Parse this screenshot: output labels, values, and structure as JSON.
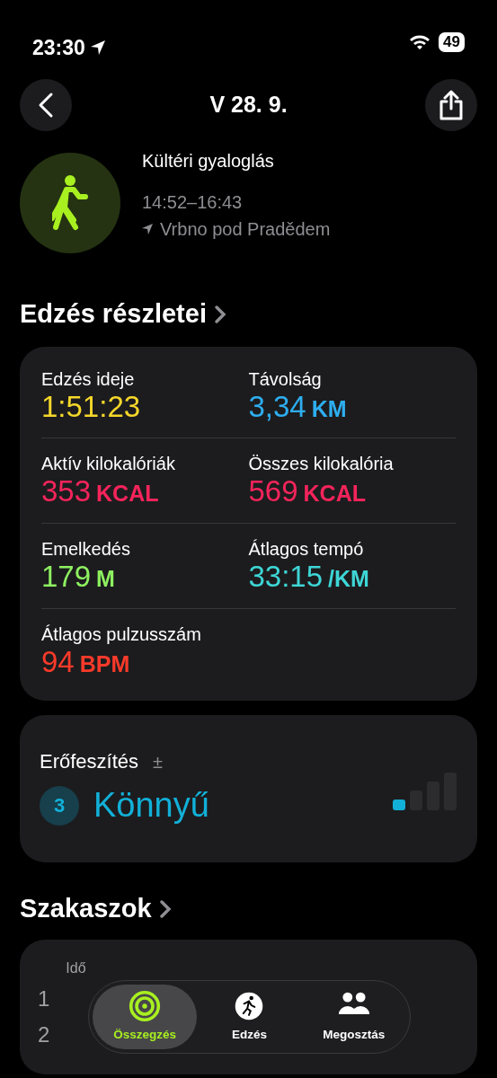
{
  "status_bar": {
    "time": "23:30",
    "battery": "49"
  },
  "header": {
    "title": "V 28. 9."
  },
  "workout": {
    "name": "Kültéri gyaloglás",
    "time_range": "14:52–16:43",
    "location": "Vrbno pod Pradědem"
  },
  "details": {
    "title": "Edzés részletei",
    "metrics": [
      {
        "label": "Edzés ideje",
        "value": "1:51:23",
        "color": "#f5d72a"
      },
      {
        "label": "Távolság",
        "value": "3,34",
        "unit": "KM",
        "color": "#2eaef0"
      },
      {
        "label": "Aktív kilokalóriák",
        "value": "353",
        "unit": "KCAL",
        "color": "#f5245b"
      },
      {
        "label": "Összes kilokalória",
        "value": "569",
        "unit": "KCAL",
        "color": "#f5245b"
      },
      {
        "label": "Emelkedés",
        "value": "179",
        "unit": "M",
        "color": "#8ef060"
      },
      {
        "label": "Átlagos tempó",
        "value": "33:15",
        "unit": "/KM",
        "color": "#3ed6d6"
      },
      {
        "label": "Átlagos pulzusszám",
        "value": "94",
        "unit": "BPM",
        "color": "#fa3a2a"
      }
    ]
  },
  "effort": {
    "label": "Erőfeszítés",
    "adjust": "±",
    "score": "3",
    "rating": "Könnyű",
    "level": 0.25
  },
  "segments": {
    "title": "Szakaszok",
    "column_1": "Idő",
    "rows": [
      {
        "index": "1"
      },
      {
        "index": "2"
      }
    ]
  },
  "tabs": [
    {
      "label": "Összegzés",
      "kind": "rings",
      "selected": true
    },
    {
      "label": "Edzés",
      "kind": "run",
      "selected": false
    },
    {
      "label": "Megosztás",
      "kind": "people",
      "selected": false
    }
  ]
}
